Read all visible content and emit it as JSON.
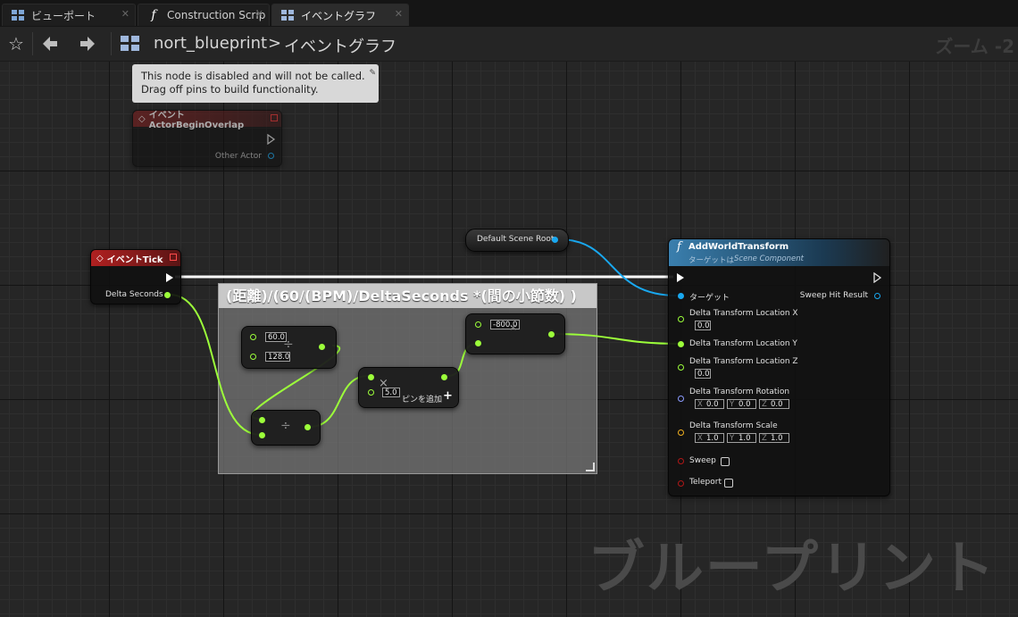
{
  "tabs": [
    {
      "label": "ビューポート",
      "icon": "viewport-grid-icon"
    },
    {
      "label": "Construction Scrip",
      "icon": "function-icon"
    },
    {
      "label": "イベントグラフ",
      "icon": "event-graph-icon"
    }
  ],
  "toolbar": {
    "breadcrumb_root": "nort_blueprint",
    "breadcrumb_sep": ">",
    "breadcrumb_current": "イベントグラフ",
    "zoom": "ズーム -2"
  },
  "graph": {
    "watermark": "ブループリント",
    "tooltip": {
      "line1": "This node is disabled and will not be called.",
      "line2": "Drag off pins to build functionality."
    },
    "overlap_node": {
      "title": "イベント ActorBeginOverlap",
      "pin_other_actor": "Other Actor"
    },
    "tick_node": {
      "title": "イベントTick",
      "pin_delta": "Delta Seconds"
    },
    "scene_root_node": {
      "label": "Default Scene Root"
    },
    "comment": {
      "title": "(距離)/(60/(BPM)/DeltaSeconds *(間の小節数) )"
    },
    "divide_node_1": {
      "a": "60.0",
      "b": "128.0",
      "op": "÷"
    },
    "divide_node_2": {
      "op": "÷"
    },
    "multiply_node": {
      "b": "5.0",
      "op": "×",
      "add_pin": "ピンを追加",
      "plus": "+"
    },
    "multiply_node_2": {
      "a": "-800.0",
      "op": "×"
    },
    "add_world_transform": {
      "title": "AddWorldTransform",
      "subtitle": "ターゲットは",
      "subtitle_class": "Scene Component",
      "pin_target": "ターゲット",
      "pin_sweep_hit": "Sweep Hit Result",
      "loc_x": {
        "label": "Delta Transform Location X",
        "value": "0.0"
      },
      "loc_y": {
        "label": "Delta Transform Location Y"
      },
      "loc_z": {
        "label": "Delta Transform Location Z",
        "value": "0.0"
      },
      "rotation": {
        "label": "Delta Transform Rotation",
        "x": "0.0",
        "y": "0.0",
        "z": "0.0"
      },
      "scale": {
        "label": "Delta Transform Scale",
        "x": "1.0",
        "y": "1.0",
        "z": "1.0"
      },
      "axis_x": "X",
      "axis_y": "Y",
      "axis_z": "Z",
      "sweep": "Sweep",
      "teleport": "Teleport"
    }
  }
}
